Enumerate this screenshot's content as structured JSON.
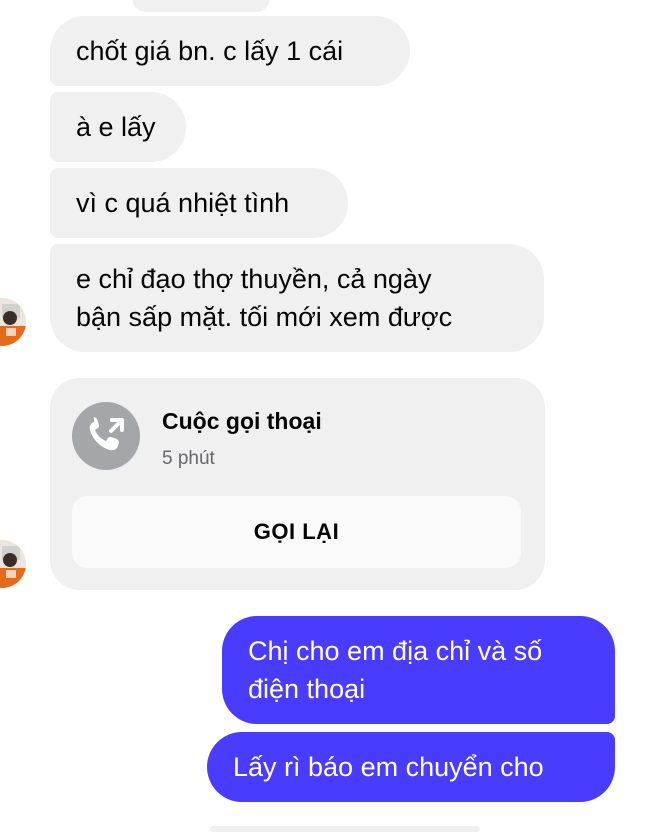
{
  "messages_in": [
    {
      "text": "chốt giá bn. c lấy 1 cái"
    },
    {
      "text": "à e lấy"
    },
    {
      "text": "vì c quá nhiệt tình"
    },
    {
      "line1": "e chỉ đạo thợ thuyền, cả ngày",
      "line2": "bận sấp mặt. tối mới xem được"
    }
  ],
  "call": {
    "title": "Cuộc gọi thoại",
    "duration": "5 phút",
    "callback_label": "GỌI LẠI",
    "icon": "missed-call-icon"
  },
  "messages_out": [
    {
      "line1": "Chị cho em địa chỉ và số",
      "line2": "điện thoại"
    },
    {
      "text": "Lấy rì báo em chuyển cho"
    }
  ],
  "colors": {
    "incoming_bubble": "#f0f0f0",
    "outgoing_bubble": "#4a3cff",
    "call_icon_bg": "#a4a6aa"
  }
}
